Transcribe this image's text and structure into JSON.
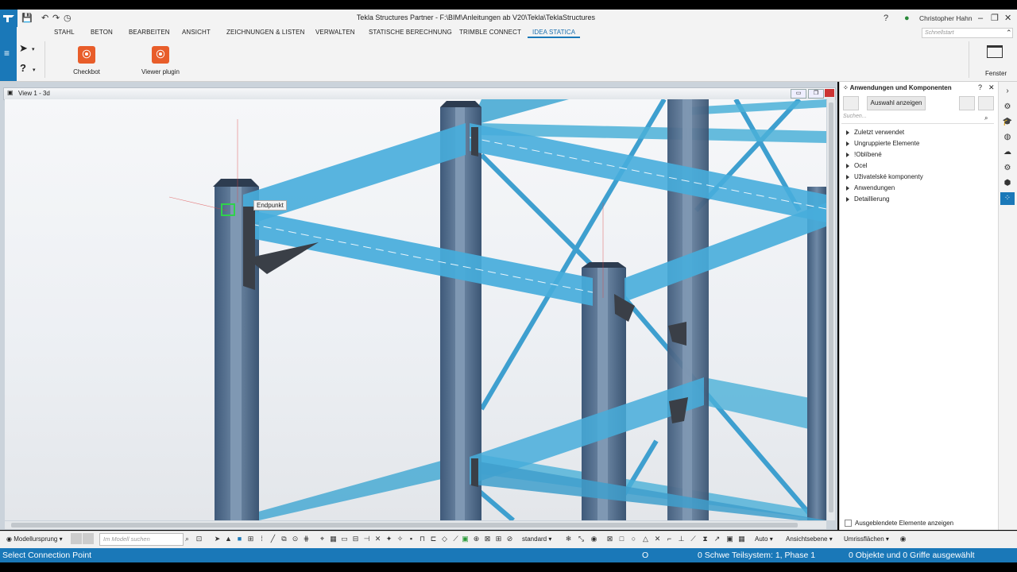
{
  "titlebar": {
    "title": "Tekla Structures Partner - F:\\BIM\\Anleitungen ab V20\\Tekla\\TeklaStructures",
    "user": "Christopher Hahn",
    "help_icon": "help-icon",
    "user_icon": "person-icon"
  },
  "menu": {
    "items": [
      "STAHL",
      "BETON",
      "BEARBEITEN",
      "ANSICHT",
      "ZEICHNUNGEN & LISTEN",
      "VERWALTEN",
      "STATISCHE BERECHNUNG",
      "TRIMBLE CONNECT",
      "IDEA STATICA"
    ],
    "active": "IDEA STATICA",
    "search_placeholder": "Schnellstart"
  },
  "ribbon": {
    "buttons": [
      {
        "label": "Checkbot",
        "icon": "idea-statica-icon"
      },
      {
        "label": "Viewer plugin",
        "icon": "idea-statica-icon"
      }
    ],
    "window_label": "Fenster"
  },
  "view": {
    "title": "View 1 - 3d",
    "tooltip": "Endpunkt"
  },
  "panel": {
    "title": "Anwendungen und Komponenten",
    "select_button": "Auswahl anzeigen",
    "search_placeholder": "Suchen...",
    "tree": [
      "Zuletzt verwendet",
      "Ungruppierte Elemente",
      "!Oblíbené",
      "Ocel",
      "Uživatelské komponenty",
      "Anwendungen",
      "Detaillierung"
    ],
    "show_hidden": "Ausgeblendete Elemente anzeigen"
  },
  "bottombar": {
    "origin": "Modellursprung",
    "model_search_placeholder": "Im Modell suchen",
    "filter": "standard",
    "auto": "Auto",
    "plane": "Ansichtsebene",
    "surfaces": "Umrissflächen"
  },
  "status": {
    "prompt": "Select Connection Point",
    "o": "O",
    "phase": "0 Schwe Teilsystem: 1, Phase 1",
    "selection": "0 Objekte und 0 Griffe ausgewählt"
  },
  "colors": {
    "accent": "#1a78b8",
    "steel": "#5aaed0",
    "idea_orange": "#e85d2a"
  }
}
